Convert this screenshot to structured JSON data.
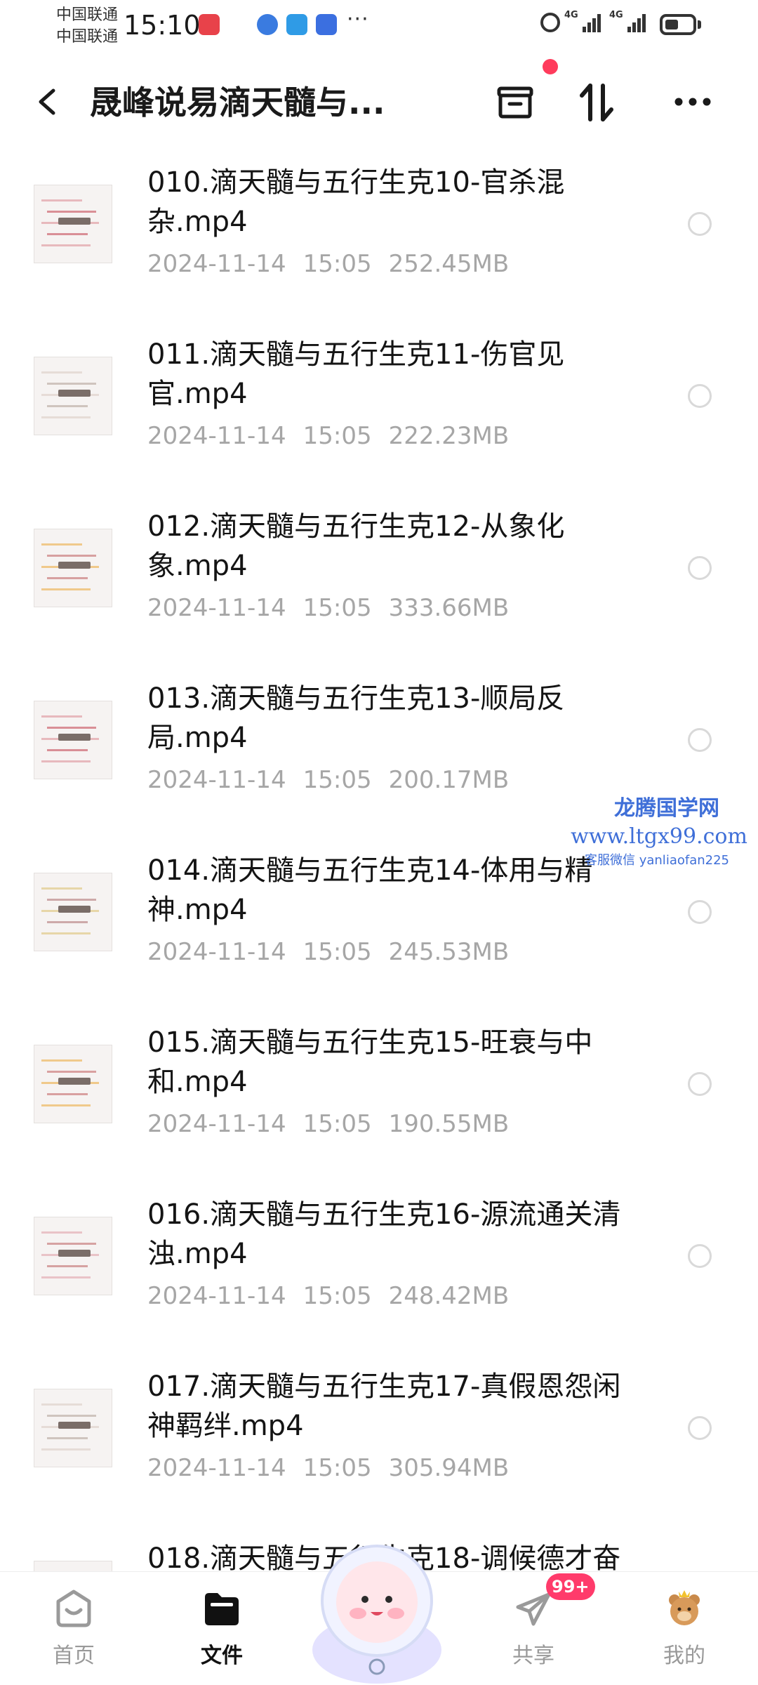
{
  "status_bar": {
    "carrier_1": "中国联通",
    "carrier_2": "中国联通",
    "time": "15:10",
    "more": "···",
    "network_1": "4G",
    "network_2": "4G",
    "battery_level": 0.5
  },
  "header": {
    "title": "晟峰说易滴天髓与..."
  },
  "files": [
    {
      "name": "010.滴天髓与五行生克10-官杀混杂.mp4",
      "date": "2024-11-14",
      "time": "15:05",
      "size": "252.45MB"
    },
    {
      "name": "011.滴天髓与五行生克11-伤官见官.mp4",
      "date": "2024-11-14",
      "time": "15:05",
      "size": "222.23MB"
    },
    {
      "name": "012.滴天髓与五行生克12-从象化象.mp4",
      "date": "2024-11-14",
      "time": "15:05",
      "size": "333.66MB"
    },
    {
      "name": "013.滴天髓与五行生克13-顺局反局.mp4",
      "date": "2024-11-14",
      "time": "15:05",
      "size": "200.17MB"
    },
    {
      "name": "014.滴天髓与五行生克14-体用与精神.mp4",
      "date": "2024-11-14",
      "time": "15:05",
      "size": "245.53MB"
    },
    {
      "name": "015.滴天髓与五行生克15-旺衰与中和.mp4",
      "date": "2024-11-14",
      "time": "15:05",
      "size": "190.55MB"
    },
    {
      "name": "016.滴天髓与五行生克16-源流通关清浊.mp4",
      "date": "2024-11-14",
      "time": "15:05",
      "size": "248.42MB"
    },
    {
      "name": "017.滴天髓与五行生克17-真假恩怨闲神羁绊.mp4",
      "date": "2024-11-14",
      "time": "15:05",
      "size": "305.94MB"
    },
    {
      "name": "018.滴天髓与五行生克18-调候德才奋",
      "date": "",
      "time": "",
      "size": ""
    }
  ],
  "watermark": {
    "line1": "龙腾国学网",
    "line2": "www.ltgx99.com",
    "line3": "客服微信 yanliaofan225"
  },
  "bottom_nav": {
    "items": [
      {
        "label": "首页",
        "active": false
      },
      {
        "label": "文件",
        "active": true
      },
      {
        "label": "共享",
        "active": false
      },
      {
        "label": "我的",
        "active": false
      }
    ],
    "share_badge": "99+"
  },
  "colors": {
    "accent_red": "#ff3b5c",
    "badge": "#ff3b6b",
    "meta_text": "#a6a6a6",
    "watermark": "#3f6fd8"
  }
}
